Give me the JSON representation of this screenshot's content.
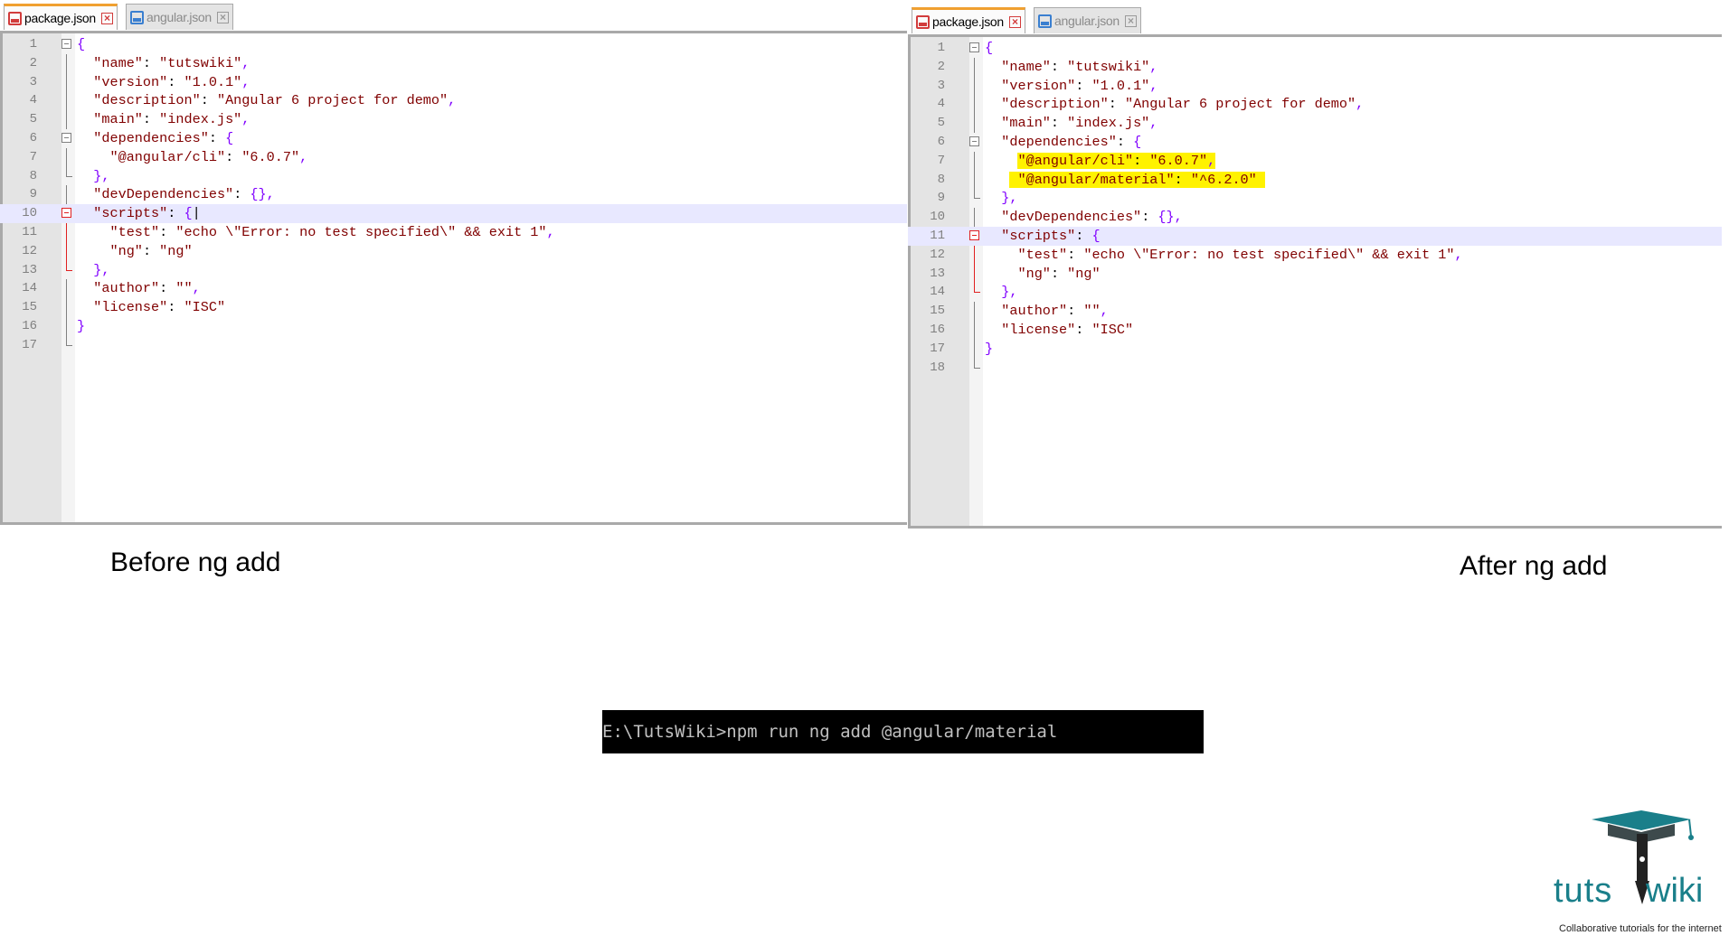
{
  "left_editor": {
    "tabs": [
      {
        "label": "package.json",
        "active": true
      },
      {
        "label": "angular.json",
        "active": false
      }
    ],
    "current_line": 10
  },
  "right_editor": {
    "tabs": [
      {
        "label": "package.json",
        "active": true
      },
      {
        "label": "angular.json",
        "active": false
      }
    ],
    "current_line": 11
  },
  "captions": {
    "before": "Before ng add",
    "after": "After ng add"
  },
  "terminal": {
    "command": "E:\\TutsWiki>npm run ng add @angular/material"
  },
  "logo": {
    "brand_left": "tuts",
    "brand_right": "wiki",
    "tagline": "Collaborative tutorials for the internet"
  },
  "colors": {
    "highlight": "#fff200",
    "key": "#000080",
    "string": "#800000",
    "punct": "#8000ff",
    "active_tab_accent": "#f0a030",
    "brand": "#1a7f8a"
  }
}
